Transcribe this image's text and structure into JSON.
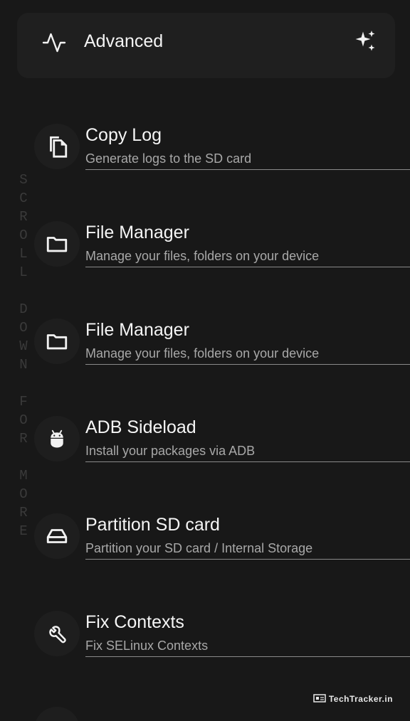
{
  "header": {
    "title": "Advanced",
    "left_icon": "activity-icon",
    "right_icon": "sparkle-icon"
  },
  "side_text": {
    "letters": [
      "S",
      "C",
      "R",
      "O",
      "L",
      "L",
      " ",
      "D",
      "O",
      "W",
      "N",
      " ",
      "F",
      "O",
      "R",
      " ",
      "M",
      "O",
      "R",
      "E"
    ]
  },
  "items": [
    {
      "title": "Copy Log",
      "subtitle": "Generate logs to the SD card",
      "icon": "copy-icon"
    },
    {
      "title": "File Manager",
      "subtitle": "Manage your files, folders on your device",
      "icon": "folder-icon"
    },
    {
      "title": "File Manager",
      "subtitle": "Manage your files, folders on your device",
      "icon": "folder-icon"
    },
    {
      "title": "ADB Sideload",
      "subtitle": "Install your packages via ADB",
      "icon": "android-icon"
    },
    {
      "title": "Partition SD card",
      "subtitle": "Partition your SD card / Internal Storage",
      "icon": "storage-icon"
    },
    {
      "title": "Fix Contexts",
      "subtitle": "Fix SELinux Contexts",
      "icon": "wrench-icon"
    }
  ],
  "watermark": {
    "text": "TechTracker.in"
  },
  "colors": {
    "background": "#181818",
    "card": "#1f1f1f",
    "text": "#f2f2f2",
    "subtext": "#a8a8a8",
    "divider": "#8a8a8a"
  }
}
